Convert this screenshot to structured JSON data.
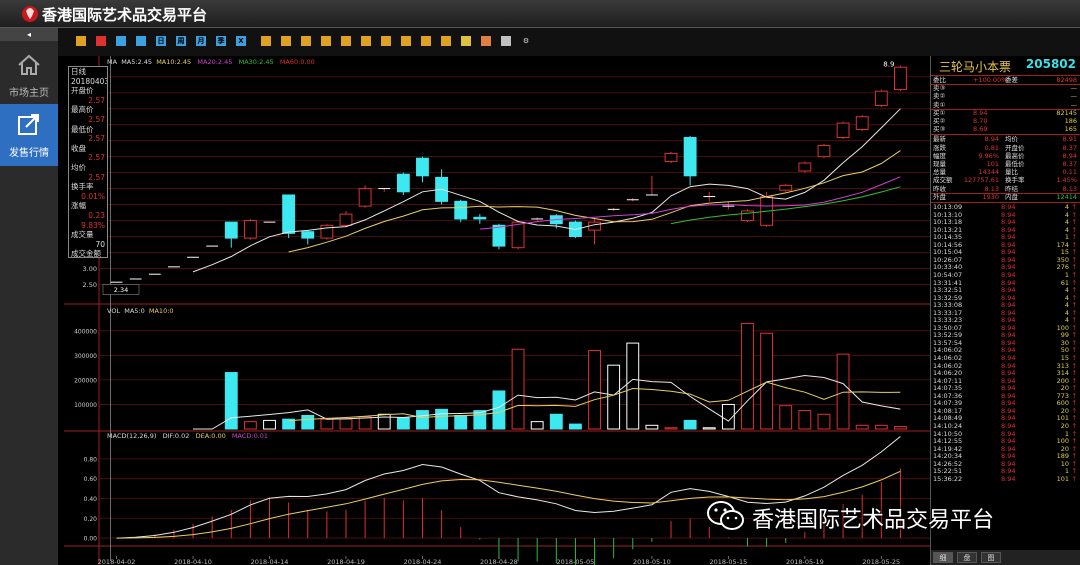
{
  "app": {
    "title": "香港国际艺术品交易平台"
  },
  "sidebar": {
    "collapse_label": "◂",
    "items": [
      {
        "label": "市场主页",
        "icon": "home-icon",
        "active": false
      },
      {
        "label": "发售行情",
        "icon": "share-icon",
        "active": true
      }
    ]
  },
  "toolbar": {
    "icons": [
      "bar-chart-icon",
      "trend-icon",
      "candle-icon",
      "calendar-icon",
      "day-icon",
      "week-icon",
      "month-icon",
      "quarter-icon",
      "year-icon",
      "tool-1-icon",
      "tool-2-icon",
      "tool-3-icon",
      "tool-4-icon",
      "tool-5-icon",
      "tool-6-icon",
      "tool-7-icon",
      "tool-8-icon",
      "tool-9-icon",
      "tool-10-icon",
      "zoom-in-icon",
      "zoom-out-icon",
      "draw-icon",
      "settings-icon"
    ],
    "labels": [
      "",
      "",
      "",
      "",
      "日",
      "周",
      "月",
      "季",
      "X",
      "",
      "",
      "",
      "",
      "",
      "",
      "",
      "",
      "",
      "",
      "",
      "",
      "",
      "⚙"
    ]
  },
  "info_box": {
    "rows": [
      {
        "k": "日线",
        "v": ""
      },
      {
        "k": "20180403",
        "v": ""
      },
      {
        "k": "开盘价",
        "v": "2.57"
      },
      {
        "k": "最高价",
        "v": "2.57"
      },
      {
        "k": "最低价",
        "v": "2.57"
      },
      {
        "k": "收盘",
        "v": "2.57"
      },
      {
        "k": "均价",
        "v": "2.57"
      },
      {
        "k": "换手率",
        "v": "0.01%"
      },
      {
        "k": "涨幅",
        "v": "0.23"
      },
      {
        "k": "",
        "v": "9.83%"
      },
      {
        "k": "成交量",
        "v": "70"
      },
      {
        "k": "成交金额",
        "v": "179.90"
      }
    ]
  },
  "indicators": {
    "ma": {
      "title": "MA",
      "ma5": "MA5:2.45",
      "ma10": "MA10:2.45",
      "ma20": "MA20:2.45",
      "ma30": "MA30:2.45",
      "ma60": "MA60:0.00"
    },
    "vol": {
      "title": "VOL",
      "ma5": "MA5:0",
      "ma10": "MA10:0"
    },
    "macd": {
      "title": "MACD(12,26,9)",
      "dif": "DIF:0.02",
      "dea": "DEA:0.00",
      "macd": "MACD:0.01"
    },
    "crosshair_price": "2.34",
    "last_price_label": "8.9"
  },
  "chart_data": [
    {
      "type": "candlestick",
      "title": "日线",
      "y_ticks": [
        "3.50",
        "3.00",
        "2.50"
      ],
      "dates": [
        "2018-04-02",
        "2018-04-10",
        "2018-04-14",
        "2018-04-19",
        "2018-04-24",
        "2018-04-28",
        "2018-05-05",
        "2018-05-10",
        "2018-05-15",
        "2018-05-19",
        "2018-05-25"
      ],
      "candles": [
        {
          "o": 2.57,
          "c": 2.57,
          "h": 2.57,
          "l": 2.57
        },
        {
          "o": 2.67,
          "c": 2.67,
          "h": 2.67,
          "l": 2.67
        },
        {
          "o": 2.82,
          "c": 2.82,
          "h": 2.82,
          "l": 2.82
        },
        {
          "o": 3.05,
          "c": 3.05,
          "h": 3.05,
          "l": 3.05
        },
        {
          "o": 3.35,
          "c": 3.35,
          "h": 3.35,
          "l": 3.35
        },
        {
          "o": 3.7,
          "c": 3.7,
          "h": 3.7,
          "l": 3.7
        },
        {
          "o": 4.45,
          "c": 3.95,
          "h": 4.45,
          "l": 3.65
        },
        {
          "o": 3.95,
          "c": 4.5,
          "h": 4.55,
          "l": 3.9
        },
        {
          "o": 4.45,
          "c": 4.45,
          "h": 4.45,
          "l": 4.45
        },
        {
          "o": 5.3,
          "c": 4.1,
          "h": 5.3,
          "l": 3.95
        },
        {
          "o": 4.15,
          "c": 3.95,
          "h": 4.2,
          "l": 3.75
        },
        {
          "o": 3.95,
          "c": 4.35,
          "h": 4.4,
          "l": 3.9
        },
        {
          "o": 4.35,
          "c": 4.7,
          "h": 4.8,
          "l": 4.3
        },
        {
          "o": 4.95,
          "c": 5.5,
          "h": 5.6,
          "l": 4.9
        },
        {
          "o": 5.5,
          "c": 5.5,
          "h": 5.5,
          "l": 5.4
        },
        {
          "o": 5.95,
          "c": 5.4,
          "h": 6.0,
          "l": 5.3
        },
        {
          "o": 6.45,
          "c": 5.9,
          "h": 6.5,
          "l": 5.7
        },
        {
          "o": 5.85,
          "c": 5.1,
          "h": 6.1,
          "l": 5.0
        },
        {
          "o": 5.1,
          "c": 4.55,
          "h": 5.15,
          "l": 4.45
        },
        {
          "o": 4.6,
          "c": 4.55,
          "h": 4.7,
          "l": 4.4
        },
        {
          "o": 4.35,
          "c": 3.7,
          "h": 4.4,
          "l": 3.6
        },
        {
          "o": 3.65,
          "c": 4.45,
          "h": 4.5,
          "l": 3.6
        },
        {
          "o": 4.55,
          "c": 4.55,
          "h": 4.6,
          "l": 4.5
        },
        {
          "o": 4.65,
          "c": 4.4,
          "h": 4.7,
          "l": 4.25
        },
        {
          "o": 4.45,
          "c": 4.0,
          "h": 4.5,
          "l": 3.95
        },
        {
          "o": 4.2,
          "c": 4.45,
          "h": 4.55,
          "l": 3.75
        },
        {
          "o": 4.85,
          "c": 4.85,
          "h": 4.9,
          "l": 4.8
        },
        {
          "o": 5.15,
          "c": 5.15,
          "h": 5.2,
          "l": 5.1
        },
        {
          "o": 5.3,
          "c": 5.3,
          "h": 5.9,
          "l": 5.3
        },
        {
          "o": 6.35,
          "c": 6.6,
          "h": 6.65,
          "l": 6.3
        },
        {
          "o": 7.1,
          "c": 5.9,
          "h": 7.15,
          "l": 5.6
        },
        {
          "o": 5.25,
          "c": 5.25,
          "h": 5.4,
          "l": 5.1
        },
        {
          "o": 4.95,
          "c": 4.95,
          "h": 5.1,
          "l": 4.85
        },
        {
          "o": 4.5,
          "c": 4.8,
          "h": 4.85,
          "l": 4.45
        },
        {
          "o": 4.35,
          "c": 5.25,
          "h": 5.4,
          "l": 4.3
        },
        {
          "o": 5.45,
          "c": 5.6,
          "h": 5.65,
          "l": 5.4
        },
        {
          "o": 6.05,
          "c": 6.3,
          "h": 6.35,
          "l": 6.0
        },
        {
          "o": 6.5,
          "c": 6.85,
          "h": 6.9,
          "l": 6.45
        },
        {
          "o": 7.1,
          "c": 7.55,
          "h": 7.6,
          "l": 7.05
        },
        {
          "o": 7.35,
          "c": 7.75,
          "h": 7.8,
          "l": 7.3
        },
        {
          "o": 8.1,
          "c": 8.55,
          "h": 8.6,
          "l": 8.05
        },
        {
          "o": 8.6,
          "c": 9.3,
          "h": 9.35,
          "l": 8.55
        }
      ]
    },
    {
      "type": "bar",
      "title": "VOL",
      "y_ticks": [
        "400000",
        "300000",
        "200000",
        "100000"
      ],
      "values": [
        0,
        0,
        0,
        0,
        0,
        0,
        230000,
        30000,
        35000,
        40000,
        55000,
        40000,
        40000,
        50000,
        60000,
        45000,
        75000,
        80000,
        55000,
        75000,
        155000,
        325000,
        30000,
        60000,
        20000,
        320000,
        260000,
        350000,
        15000,
        5000,
        35000,
        5000,
        100000,
        430000,
        390000,
        95000,
        75000,
        60000,
        305000,
        15000,
        15000,
        10000
      ],
      "ylim": [
        0,
        440000
      ]
    },
    {
      "type": "bar",
      "title": "MACD(12,26,9)",
      "y_ticks": [
        "0.80",
        "0.60",
        "0.40",
        "0.20",
        "0.00"
      ],
      "ylim": [
        -0.08,
        0.9
      ]
    }
  ],
  "right_panel": {
    "name": "三轮马小本票",
    "code": "205802",
    "order_rows": [
      {
        "k": "委比",
        "v": "+100.00%",
        "k2": "委差",
        "v2": "82498"
      },
      {
        "k": "卖③",
        "v": "",
        "v2": "—"
      },
      {
        "k": "卖②",
        "v": "",
        "v2": "—"
      },
      {
        "k": "卖①",
        "v": "",
        "v2": "—"
      },
      {
        "k": "买①",
        "v": "8.94",
        "v2": "82145"
      },
      {
        "k": "买②",
        "v": "8.70",
        "v2": "186"
      },
      {
        "k": "买③",
        "v": "8.69",
        "v2": "165"
      }
    ],
    "stat_rows": [
      {
        "k": "最新",
        "v": "8.94",
        "k2": "均价",
        "v2": "8.91"
      },
      {
        "k": "涨跌",
        "v": "0.81",
        "k2": "开盘价",
        "v2": "8.37"
      },
      {
        "k": "幅度",
        "v": "9.96%",
        "k2": "最高价",
        "v2": "8.94"
      },
      {
        "k": "现量",
        "v": "101",
        "k2": "最低价",
        "v2": "8.37"
      },
      {
        "k": "总量",
        "v": "14344",
        "k2": "量比",
        "v2": "0.11"
      },
      {
        "k": "成交额",
        "v": "127757.61",
        "k2": "换手率",
        "v2": "1.45%"
      },
      {
        "k": "昨收",
        "v": "8.13",
        "k2": "昨结",
        "v2": "8.13"
      },
      {
        "k": "外盘",
        "v": "1930",
        "k2": "内盘",
        "v2": "12414"
      }
    ],
    "trades": [
      [
        "10:13:09",
        "8.94",
        "4"
      ],
      [
        "10:13:10",
        "8.94",
        "4"
      ],
      [
        "10:13:18",
        "8.94",
        "4"
      ],
      [
        "10:13:21",
        "8.94",
        "4"
      ],
      [
        "10:14:35",
        "8.94",
        "1"
      ],
      [
        "10:14:56",
        "8.94",
        "174"
      ],
      [
        "10:15:04",
        "8.94",
        "15"
      ],
      [
        "10:26:07",
        "8.94",
        "350"
      ],
      [
        "10:33:40",
        "8.94",
        "276"
      ],
      [
        "10:54:07",
        "8.94",
        "1"
      ],
      [
        "13:31:41",
        "8.94",
        "61"
      ],
      [
        "13:32:51",
        "8.94",
        "4"
      ],
      [
        "13:32:59",
        "8.94",
        "4"
      ],
      [
        "13:33:08",
        "8.94",
        "4"
      ],
      [
        "13:33:17",
        "8.94",
        "4"
      ],
      [
        "13:33:23",
        "8.94",
        "4"
      ],
      [
        "13:50:07",
        "8.94",
        "100"
      ],
      [
        "13:52:59",
        "8.94",
        "99"
      ],
      [
        "13:57:54",
        "8.94",
        "30"
      ],
      [
        "14:06:02",
        "8.94",
        "50"
      ],
      [
        "14:06:02",
        "8.94",
        "15"
      ],
      [
        "14:06:02",
        "8.94",
        "313"
      ],
      [
        "14:06:20",
        "8.94",
        "314"
      ],
      [
        "14:07:11",
        "8.94",
        "200"
      ],
      [
        "14:07:35",
        "8.94",
        "20"
      ],
      [
        "14:07:36",
        "8.94",
        "773"
      ],
      [
        "14:07:39",
        "8.94",
        "600"
      ],
      [
        "14:08:17",
        "8.94",
        "20"
      ],
      [
        "14:08:49",
        "8.94",
        "101"
      ],
      [
        "14:10:24",
        "8.94",
        "20"
      ],
      [
        "14:10:50",
        "8.94",
        "1"
      ],
      [
        "14:12:55",
        "8.94",
        "100"
      ],
      [
        "14:19:42",
        "8.94",
        "20"
      ],
      [
        "14:20:34",
        "8.94",
        "189"
      ],
      [
        "14:26:52",
        "8.94",
        "10"
      ],
      [
        "15:22:51",
        "8.94",
        "1"
      ],
      [
        "15:36:22",
        "8.94",
        "101"
      ]
    ],
    "tabs": [
      "细",
      "盘",
      "图"
    ]
  },
  "watermark": {
    "text": "香港国际艺术品交易平台",
    "icon": "wechat-icon"
  }
}
